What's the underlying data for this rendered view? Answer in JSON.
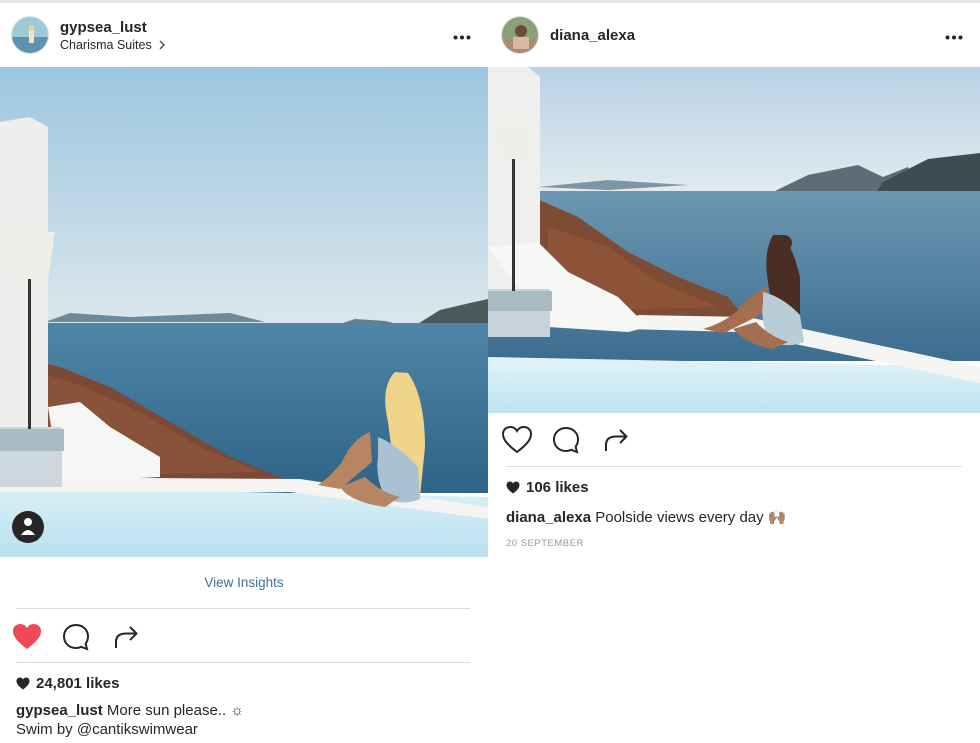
{
  "left_post": {
    "username": "gypsea_lust",
    "location": "Charisma Suites",
    "view_insights": "View Insights",
    "likes": "24,801 likes",
    "caption_user": "gypsea_lust",
    "caption_text": "More sun please.. ☼",
    "caption_line2": "Swim by @cantikswimwear",
    "liked": true,
    "like_color": "#ed4956"
  },
  "right_post": {
    "username": "diana_alexa",
    "likes": "106 likes",
    "caption_user": "diana_alexa",
    "caption_text": "Poolside views every day 🙌🏽",
    "date": "20 SEPTEMBER",
    "liked": false
  },
  "colors": {
    "link": "#3f729b",
    "text": "#262626",
    "divider": "#dbdbdb",
    "like_active": "#ed4956"
  },
  "icons": [
    "more-options-icon",
    "chevron-right-icon",
    "user-tag-icon",
    "heart-icon",
    "comment-icon",
    "share-icon",
    "heart-small-icon"
  ]
}
